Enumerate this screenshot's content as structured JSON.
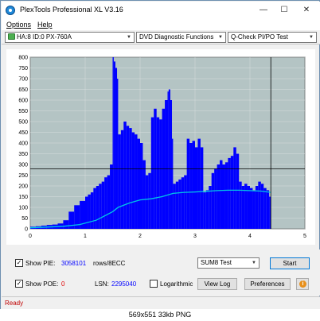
{
  "window": {
    "title": "PlexTools Professional XL V3.16",
    "minimize_glyph": "—",
    "maximize_glyph": "☐",
    "close_glyph": "✕"
  },
  "menu": {
    "options": "Options",
    "help": "Help"
  },
  "toolbar": {
    "drive": "HA:8 ID:0  PX-760A",
    "function": "DVD Diagnostic Functions",
    "test": "Q-Check PI/PO Test"
  },
  "chart_data": {
    "type": "area",
    "xlim": [
      0,
      5
    ],
    "ylim": [
      0,
      800
    ],
    "x_ticks": [
      "0",
      "1",
      "2",
      "3",
      "4",
      "5"
    ],
    "y_ticks": [
      "800",
      "750",
      "700",
      "650",
      "600",
      "550",
      "500",
      "450",
      "400",
      "350",
      "300",
      "250",
      "200",
      "150",
      "100",
      "50",
      "0"
    ],
    "grid": true,
    "threshold_line": 280,
    "end_marker_x": 4.38,
    "background": "#b4c4c4",
    "colors": {
      "pie": "#0000ff",
      "sum8": "#00c8e6",
      "threshold": "#000000"
    },
    "series": [
      {
        "role": "bars",
        "x": [
          0.0,
          0.1,
          0.2,
          0.3,
          0.4,
          0.5,
          0.6,
          0.7,
          0.8,
          0.9,
          1.0,
          1.05,
          1.1,
          1.15,
          1.2,
          1.25,
          1.3,
          1.35,
          1.4,
          1.45,
          1.5,
          1.52,
          1.55,
          1.58,
          1.6,
          1.65,
          1.7,
          1.75,
          1.8,
          1.85,
          1.9,
          1.95,
          2.0,
          2.05,
          2.1,
          2.15,
          2.2,
          2.25,
          2.3,
          2.35,
          2.4,
          2.45,
          2.5,
          2.52,
          2.55,
          2.58,
          2.6,
          2.65,
          2.7,
          2.75,
          2.8,
          2.85,
          2.9,
          2.95,
          3.0,
          3.05,
          3.1,
          3.15,
          3.2,
          3.25,
          3.3,
          3.35,
          3.4,
          3.45,
          3.5,
          3.55,
          3.6,
          3.65,
          3.7,
          3.75,
          3.8,
          3.85,
          3.9,
          3.95,
          4.0,
          4.05,
          4.1,
          4.15,
          4.2,
          4.25,
          4.3,
          4.35,
          4.38
        ],
        "values": [
          10,
          12,
          15,
          18,
          20,
          25,
          40,
          80,
          110,
          130,
          150,
          160,
          170,
          190,
          200,
          210,
          220,
          240,
          250,
          300,
          800,
          780,
          750,
          700,
          440,
          460,
          500,
          480,
          470,
          450,
          440,
          420,
          400,
          320,
          250,
          260,
          520,
          560,
          520,
          510,
          560,
          600,
          640,
          650,
          600,
          420,
          210,
          220,
          230,
          240,
          250,
          420,
          400,
          410,
          380,
          420,
          380,
          170,
          180,
          200,
          260,
          280,
          300,
          320,
          300,
          310,
          330,
          340,
          380,
          350,
          220,
          200,
          210,
          200,
          190,
          180,
          200,
          220,
          210,
          190,
          180,
          150,
          140
        ]
      },
      {
        "role": "line",
        "x": [
          0.0,
          0.3,
          0.6,
          0.9,
          1.2,
          1.5,
          1.6,
          1.8,
          2.0,
          2.2,
          2.4,
          2.6,
          2.8,
          3.0,
          3.2,
          3.4,
          3.6,
          3.8,
          4.0,
          4.2,
          4.38
        ],
        "values": [
          5,
          8,
          12,
          20,
          40,
          80,
          100,
          120,
          135,
          140,
          150,
          165,
          170,
          172,
          175,
          178,
          180,
          180,
          178,
          176,
          170
        ]
      }
    ]
  },
  "controls": {
    "show_pie_label": "Show PIE:",
    "pie_value": "3058101",
    "pie_units": "rows/8ECC",
    "show_poe_label": "Show POE:",
    "poe_value": "0",
    "lsn_label": "LSN:",
    "lsn_value": "2295040",
    "logarithmic_label": "Logarithmic",
    "sum_test_value": "SUM8 Test",
    "start_label": "Start",
    "view_log_label": "View Log",
    "preferences_label": "Preferences",
    "checkmark": "✓",
    "info_glyph": "i"
  },
  "status": {
    "text": "Ready",
    "color": "#c00000"
  },
  "caption": "569x551 33kb PNG"
}
